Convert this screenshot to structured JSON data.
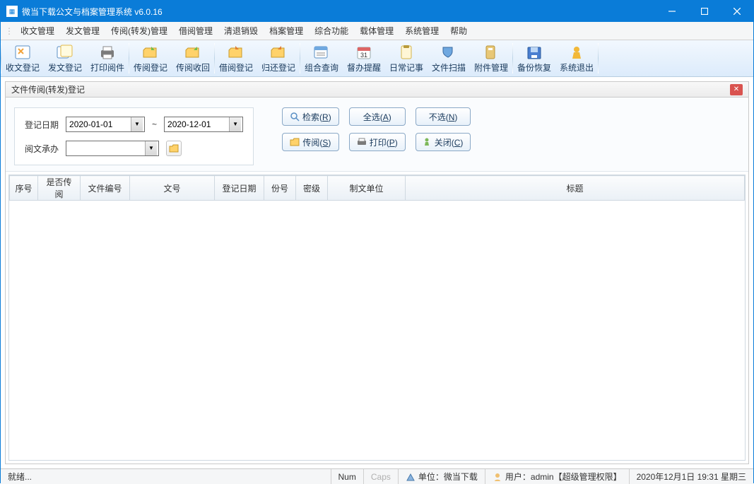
{
  "window": {
    "title": "微当下载公文与档案管理系统 v6.0.16"
  },
  "menu": {
    "items": [
      "收文管理",
      "发文管理",
      "传阅(转发)管理",
      "借阅管理",
      "清退销毁",
      "档案管理",
      "综合功能",
      "载体管理",
      "系统管理",
      "帮助"
    ]
  },
  "toolbar": {
    "groups": [
      [
        "收文登记",
        "发文登记",
        "打印阅件"
      ],
      [
        "传阅登记",
        "传阅收回"
      ],
      [
        "借阅登记",
        "归还登记"
      ],
      [
        "组合查询",
        "督办提醒",
        "日常记事",
        "文件扫描",
        "附件管理"
      ],
      [
        "备份恢复",
        "系统退出"
      ]
    ]
  },
  "panel": {
    "title": "文件传阅(转发)登记",
    "date_label": "登记日期",
    "date_from": "2020-01-01",
    "date_to": "2020-12-01",
    "reader_label": "阅文承办",
    "reader_value": "",
    "btn_search": "检索(R)",
    "btn_selectall": "全选(A)",
    "btn_none": "不选(N)",
    "btn_circulate": "传阅(S)",
    "btn_print": "打印(P)",
    "btn_close": "关闭(C)"
  },
  "grid": {
    "cols": [
      "序号",
      "是否传阅",
      "文件编号",
      "文号",
      "登记日期",
      "份号",
      "密级",
      "制文单位",
      "标题"
    ]
  },
  "status": {
    "ready": "就绪...",
    "num": "Num",
    "caps": "Caps",
    "unit": "单位：微当下载",
    "user": "用户：admin【超级管理权限】",
    "datetime": "2020年12月1日 19:31 星期三"
  }
}
